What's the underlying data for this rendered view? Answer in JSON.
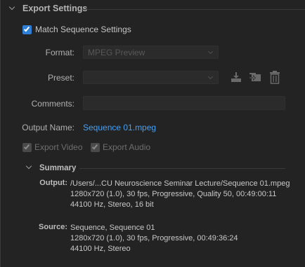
{
  "section": {
    "title": "Export Settings"
  },
  "match_sequence": {
    "label": "Match Sequence Settings",
    "checked": true
  },
  "format": {
    "label": "Format:",
    "value": "MPEG Preview"
  },
  "preset": {
    "label": "Preset:",
    "value": ""
  },
  "comments": {
    "label": "Comments:",
    "value": ""
  },
  "output_name": {
    "label": "Output Name:",
    "value": "Sequence 01.mpeg"
  },
  "export_video": {
    "label": "Export Video",
    "checked": true,
    "enabled": false
  },
  "export_audio": {
    "label": "Export Audio",
    "checked": true,
    "enabled": false
  },
  "summary": {
    "title": "Summary",
    "output_key": "Output:",
    "output_lines": [
      "/Users/...CU Neuroscience Seminar Lecture/Sequence 01.mpeg",
      "1280x720 (1.0), 30 fps, Progressive, Quality 50, 00:49:00:11",
      "44100 Hz, Stereo, 16 bit"
    ],
    "source_key": "Source:",
    "source_lines": [
      "Sequence, Sequence 01",
      "1280x720 (1.0), 30 fps, Progressive, 00:49:36:24",
      "44100 Hz, Stereo"
    ]
  },
  "icons": {
    "save_preset": "save-preset-icon",
    "import_preset": "import-preset-icon",
    "delete_preset": "trash-icon"
  },
  "colors": {
    "accent": "#2f7fd6",
    "link": "#4a9ff0",
    "background": "#232323"
  }
}
